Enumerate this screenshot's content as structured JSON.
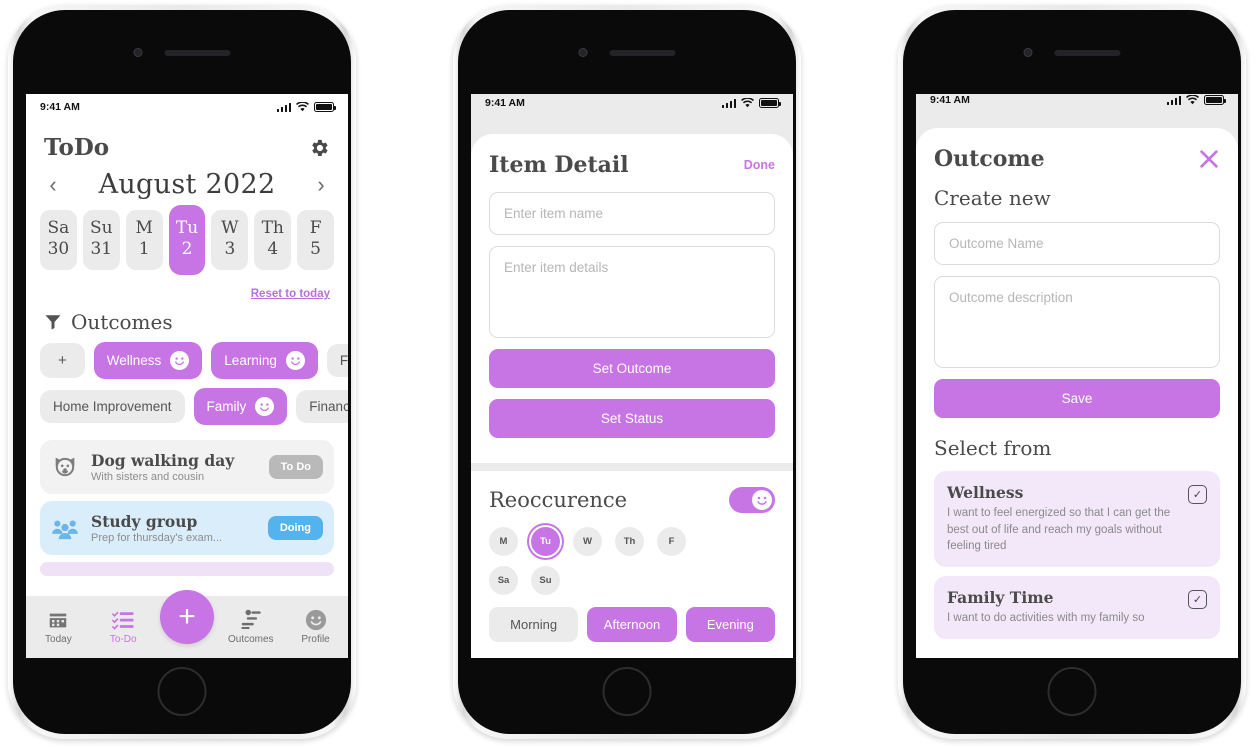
{
  "status_bar": {
    "time": "9:41 AM",
    "signal": "signal-bars-icon",
    "wifi": "wifi-icon",
    "battery": "battery-icon"
  },
  "phone1": {
    "app_title": "ToDo",
    "settings_icon": "gear-icon",
    "calendar": {
      "prev_icon": "chevron-left-icon",
      "next_icon": "chevron-right-icon",
      "month_label": "August 2022",
      "days": [
        {
          "name": "Sa",
          "num": "30",
          "selected": false
        },
        {
          "name": "Su",
          "num": "31",
          "selected": false
        },
        {
          "name": "M",
          "num": "1",
          "selected": false
        },
        {
          "name": "Tu",
          "num": "2",
          "selected": true
        },
        {
          "name": "W",
          "num": "3",
          "selected": false
        },
        {
          "name": "Th",
          "num": "4",
          "selected": false
        },
        {
          "name": "F",
          "num": "5",
          "selected": false
        }
      ],
      "reset_link": "Reset to today"
    },
    "outcomes": {
      "filter_icon": "funnel-icon",
      "label": "Outcomes",
      "add_label": "+",
      "row1": [
        {
          "label": "Wellness",
          "selected": true
        },
        {
          "label": "Learning",
          "selected": true
        },
        {
          "label": "Fun",
          "selected": false
        }
      ],
      "row2": [
        {
          "label": "Home Improvement",
          "selected": false
        },
        {
          "label": "Family",
          "selected": true
        },
        {
          "label": "Finance",
          "selected": false
        }
      ]
    },
    "tasks": [
      {
        "icon": "dog-face-icon",
        "title": "Dog walking day",
        "subtitle": "With sisters and cousin",
        "badge": "To Do",
        "theme": "grey"
      },
      {
        "icon": "people-group-icon",
        "title": "Study group",
        "subtitle": "Prep for thursday's exam...",
        "badge": "Doing",
        "theme": "blue"
      }
    ],
    "tabbar": {
      "items": [
        {
          "label": "Today",
          "icon": "calendar-icon",
          "active": false
        },
        {
          "label": "To-Do",
          "icon": "checklist-icon",
          "active": true
        }
      ],
      "fab": "+",
      "items_right": [
        {
          "label": "Outcomes",
          "icon": "outcomes-chart-icon",
          "active": false
        },
        {
          "label": "Profile",
          "icon": "smiley-face-icon",
          "active": false
        }
      ]
    }
  },
  "phone2": {
    "title": "Item Detail",
    "done_label": "Done",
    "name_placeholder": "Enter item name",
    "details_placeholder": "Enter item details",
    "set_outcome_label": "Set Outcome",
    "set_status_label": "Set Status",
    "reoccurence": {
      "title": "Reoccurence",
      "toggle_on": true,
      "days_row1": [
        {
          "label": "M",
          "selected": false
        },
        {
          "label": "Tu",
          "selected": true
        },
        {
          "label": "W",
          "selected": false
        },
        {
          "label": "Th",
          "selected": false
        },
        {
          "label": "F",
          "selected": false
        }
      ],
      "days_row2": [
        {
          "label": "Sa",
          "selected": false
        },
        {
          "label": "Su",
          "selected": false
        }
      ],
      "times": [
        {
          "label": "Morning",
          "selected": false
        },
        {
          "label": "Afternoon",
          "selected": true
        },
        {
          "label": "Evening",
          "selected": true
        }
      ]
    }
  },
  "phone3": {
    "title": "Outcome",
    "close_icon": "close-x-icon",
    "create_new_label": "Create new",
    "name_placeholder": "Outcome Name",
    "description_placeholder": "Outcome description",
    "save_label": "Save",
    "select_from_label": "Select from",
    "outcome_cards": [
      {
        "title": "Wellness",
        "description": "I want to feel energized so that I can get the best out of life and reach my goals without feeling tired",
        "checked": true
      },
      {
        "title": "Family Time",
        "description": "I want to do activities with my family so",
        "checked": true
      }
    ]
  },
  "colors": {
    "accent_purple": "#c774e4",
    "accent_purple_link": "#b86fd8",
    "doing_blue": "#53b3ef",
    "todo_grey": "#b9b9b9",
    "chip_grey": "#ebebeb",
    "card_lilac": "#f3e8f9",
    "task_blue": "#d9edfb"
  }
}
